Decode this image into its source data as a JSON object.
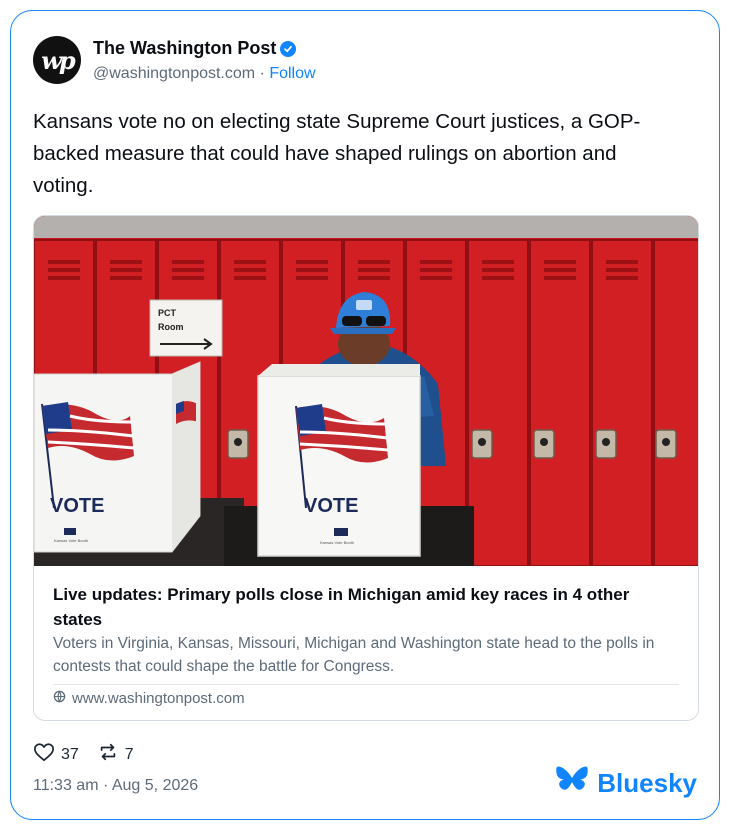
{
  "author": {
    "display_name": "The Washington Post",
    "avatar_text": "wp",
    "handle": "@washingtonpost.com",
    "separator": " · ",
    "follow_label": "Follow"
  },
  "post": {
    "text": "Kansans vote no on electing state Supreme Court justices, a GOP-backed measure that could have shaped rulings on abortion and voting."
  },
  "embed": {
    "title": "Live updates: Primary polls close in Michigan amid key races in 4 other states",
    "description": "Voters in Virginia, Kansas, Missouri, Michigan and Washington state head to the polls in contests that could shape the battle for Congress.",
    "domain": "www.washingtonpost.com",
    "photo": {
      "sign_line1": "PCT",
      "sign_line2": "Room",
      "booth_label": "VOTE",
      "booth_small_text": "Kansas Vote Booth"
    }
  },
  "stats": {
    "likes": "37",
    "reposts": "7"
  },
  "timestamp": "11:33 am · Aug 5, 2026",
  "brand": {
    "name": "Bluesky",
    "accent": "#1185fe"
  },
  "icons": [
    "verified-badge-icon",
    "heart-icon",
    "repost-icon",
    "globe-icon",
    "bluesky-butterfly-icon"
  ]
}
